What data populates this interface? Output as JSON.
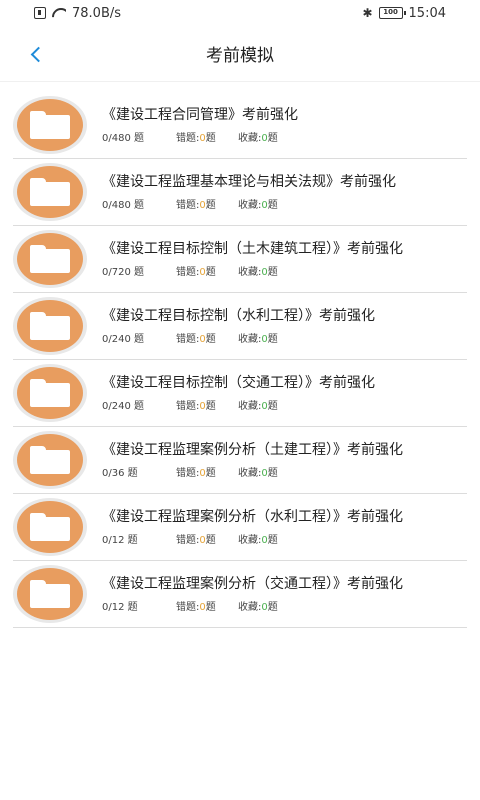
{
  "status_bar": {
    "speed": "78.0B/s",
    "battery": "100",
    "time": "15:04"
  },
  "header": {
    "title": "考前模拟"
  },
  "labels": {
    "unit": "题",
    "wrong": "错题:",
    "fav": "收藏:"
  },
  "items": [
    {
      "title": "《建设工程合同管理》考前强化",
      "progress": "0/480",
      "wrong": "0",
      "fav": "0"
    },
    {
      "title": "《建设工程监理基本理论与相关法规》考前强化",
      "progress": "0/480",
      "wrong": "0",
      "fav": "0"
    },
    {
      "title": "《建设工程目标控制（土木建筑工程）》考前强化",
      "progress": "0/720",
      "wrong": "0",
      "fav": "0"
    },
    {
      "title": "《建设工程目标控制（水利工程）》考前强化",
      "progress": "0/240",
      "wrong": "0",
      "fav": "0"
    },
    {
      "title": "《建设工程目标控制（交通工程）》考前强化",
      "progress": "0/240",
      "wrong": "0",
      "fav": "0"
    },
    {
      "title": "《建设工程监理案例分析（土建工程）》考前强化",
      "progress": "0/36",
      "wrong": "0",
      "fav": "0"
    },
    {
      "title": "《建设工程监理案例分析（水利工程）》考前强化",
      "progress": "0/12",
      "wrong": "0",
      "fav": "0"
    },
    {
      "title": "《建设工程监理案例分析（交通工程）》考前强化",
      "progress": "0/12",
      "wrong": "0",
      "fav": "0"
    }
  ]
}
